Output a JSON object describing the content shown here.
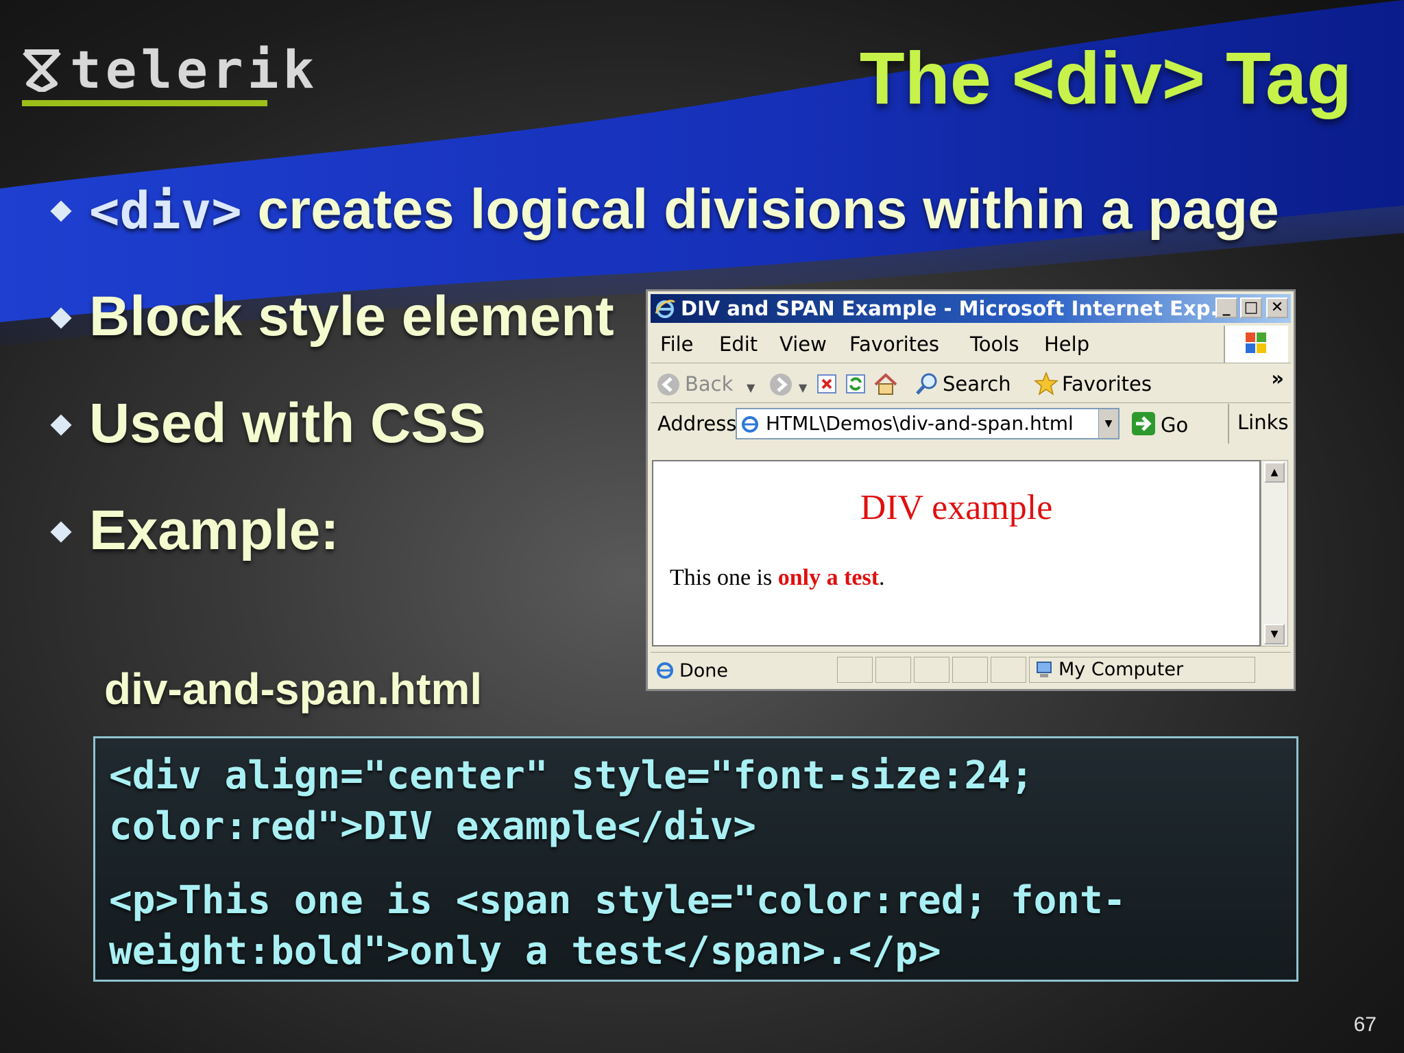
{
  "logo": {
    "text": "telerik",
    "accent": "#9cbf1a"
  },
  "title": {
    "text": "The <div> Tag",
    "color": "#c6f24a"
  },
  "bullets": [
    {
      "code": "<div>",
      "text": " creates logical divisions within a page"
    },
    {
      "text": "Block style element"
    },
    {
      "text": "Used with CSS"
    },
    {
      "text": "Example:"
    }
  ],
  "filename": "div-and-span.html",
  "code": {
    "line1": "<div align=\"center\" style=\"font-size:24;",
    "line2": "color:red\">DIV example</div>",
    "line3": "<p>This one is <span style=\"color:red; font-",
    "line4": "weight:bold\">only a test</span>.</p>"
  },
  "browser": {
    "title": "DIV and SPAN Example - Microsoft Internet Exp...",
    "menu": [
      "File",
      "Edit",
      "View",
      "Favorites",
      "Tools",
      "Help"
    ],
    "toolbar": {
      "back": "Back",
      "search": "Search",
      "favorites": "Favorites",
      "more": "»"
    },
    "address_label": "Address",
    "address_value": "HTML\\Demos\\div-and-span.html",
    "go": "Go",
    "links": "Links",
    "page": {
      "heading": "DIV example",
      "para_before": "This one is ",
      "para_bold": "only a test",
      "para_after": "."
    },
    "status": {
      "left": "Done",
      "zone": "My Computer"
    }
  },
  "page_number": "67"
}
